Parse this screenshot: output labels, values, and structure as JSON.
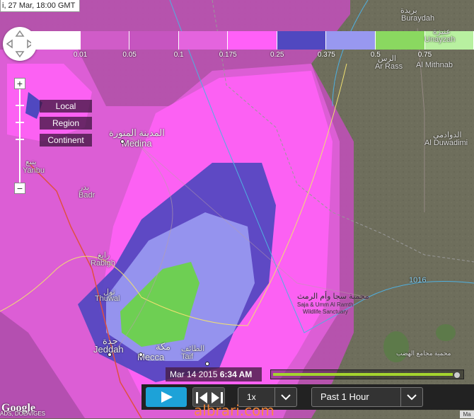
{
  "timestamp_top": "i, 27 Mar, 18:00 GMT",
  "legend": {
    "colors": [
      "#ffffff",
      "#d05cc8",
      "#c655c0",
      "#e464de",
      "#ff60f8",
      "#5048c0",
      "#9898f0",
      "#8ad860",
      "#b8f0a0"
    ],
    "labels": [
      "0.01",
      "0.05",
      "0.1",
      "0.175",
      "0.25",
      "0.375",
      "0.5",
      "0.75"
    ]
  },
  "zoom": {
    "plus": "+",
    "minus": "−"
  },
  "scale_buttons": [
    "Local",
    "Region",
    "Continent"
  ],
  "places": [
    {
      "name": "بريدة",
      "style": "normal"
    },
    {
      "name": "Buraydah",
      "style": "normal"
    },
    {
      "name": "عنيزة",
      "style": "normal"
    },
    {
      "name": "Unayzah",
      "style": "normal"
    },
    {
      "name": "الرس",
      "style": "normal"
    },
    {
      "name": "Ar Rass",
      "style": "normal"
    },
    {
      "name": "Al Mithnab",
      "style": "normal"
    },
    {
      "name": "الدوادمي",
      "style": "normal"
    },
    {
      "name": "Al Duwadimi",
      "style": "normal"
    },
    {
      "name": "المدينة المنورة",
      "style": "big"
    },
    {
      "name": "Medina",
      "style": "big"
    },
    {
      "name": "ينبع",
      "style": "normal"
    },
    {
      "name": "Yanbu",
      "style": "normal"
    },
    {
      "name": "بدر",
      "style": "normal"
    },
    {
      "name": "Badr",
      "style": "normal"
    },
    {
      "name": "رابغ",
      "style": "normal"
    },
    {
      "name": "Rabigh",
      "style": "normal"
    },
    {
      "name": "ثول",
      "style": "normal"
    },
    {
      "name": "Thuwal",
      "style": "normal"
    },
    {
      "name": "جدة",
      "style": "big"
    },
    {
      "name": "Jeddah",
      "style": "big"
    },
    {
      "name": "مكة",
      "style": "big"
    },
    {
      "name": "Mecca",
      "style": "big"
    },
    {
      "name": "الطائف",
      "style": "normal"
    },
    {
      "name": "Taif",
      "style": "normal"
    },
    {
      "name": "محمية سجا وأم الرمث",
      "style": "dark"
    },
    {
      "name": "Saja & Umm Al Ramth",
      "style": "dark"
    },
    {
      "name": "Wildlife Sanctuary",
      "style": "dark"
    },
    {
      "name": "محمية مجامع الهضب",
      "style": "dark"
    }
  ],
  "isobar_label": "1016",
  "playback": {
    "time_date": "Mar 14 2015",
    "time_clock": "6:34 AM",
    "progress_fraction": 0.97,
    "speed": "1x",
    "range": "Past 1 Hour"
  },
  "watermark": "albrari.com",
  "google_logo": "Google",
  "attribution": "ADS, DOLA/IGES",
  "attribution_right": "Ma",
  "colors": {
    "play_button": "#1da2d8",
    "progress_fill": "#a4d42e",
    "watermark": "#ff8a3a"
  }
}
